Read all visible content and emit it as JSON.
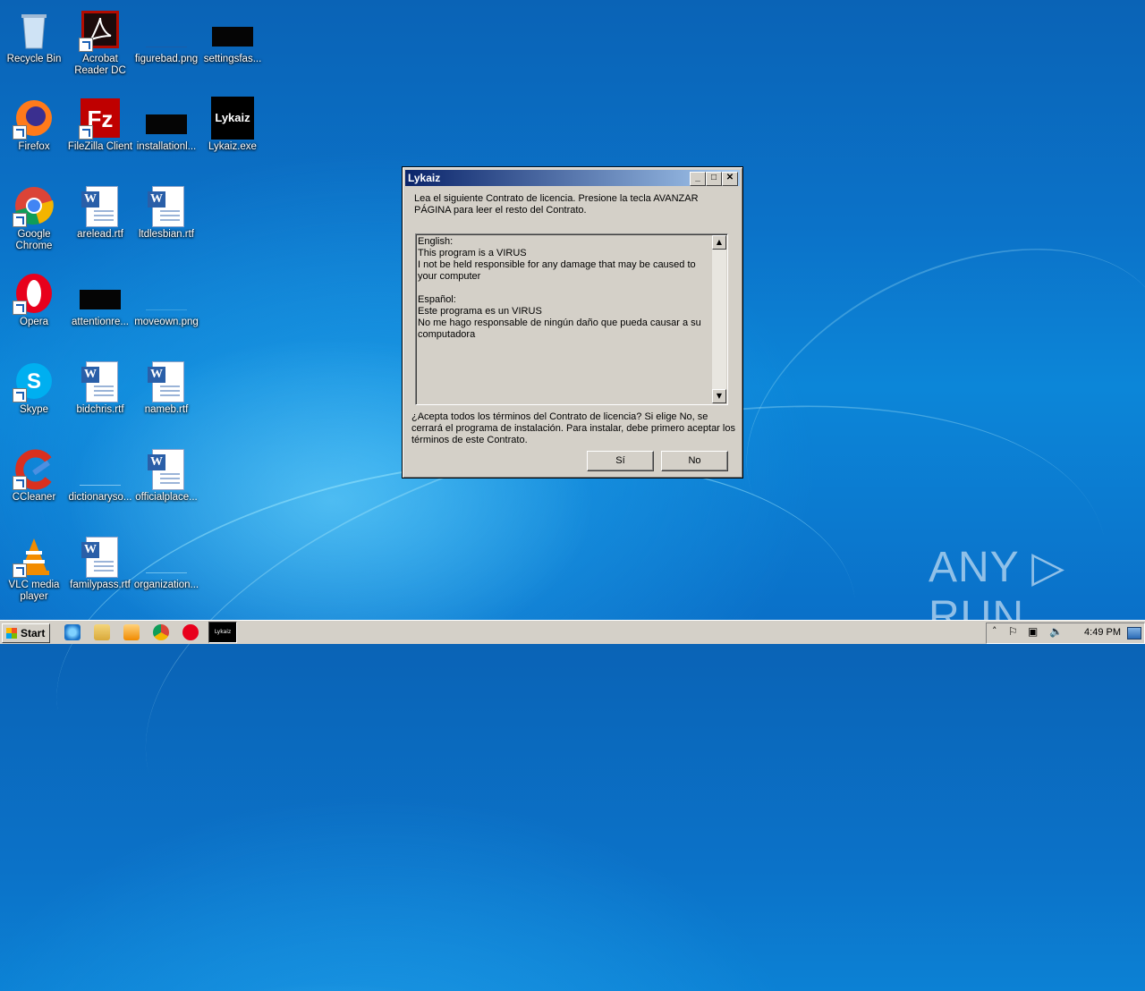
{
  "desktop": {
    "icons": [
      {
        "label": "Recycle Bin"
      },
      {
        "label": "Acrobat Reader DC"
      },
      {
        "label": "figurebad.png"
      },
      {
        "label": "settingsfas..."
      },
      {
        "label": "Firefox"
      },
      {
        "label": "FileZilla Client"
      },
      {
        "label": "installationl..."
      },
      {
        "label": "Lykaiz.exe"
      },
      {
        "label": "Google Chrome"
      },
      {
        "label": "arelead.rtf"
      },
      {
        "label": "ltdlesbian.rtf"
      },
      {
        "label": "Opera"
      },
      {
        "label": "attentionre..."
      },
      {
        "label": "moveown.png"
      },
      {
        "label": "Skype"
      },
      {
        "label": "bidchris.rtf"
      },
      {
        "label": "nameb.rtf"
      },
      {
        "label": "CCleaner"
      },
      {
        "label": "dictionaryso..."
      },
      {
        "label": "officialplace..."
      },
      {
        "label": "VLC media player"
      },
      {
        "label": "familypass.rtf"
      },
      {
        "label": "organization..."
      }
    ],
    "lykaiz_icon_text": "Lykaiz"
  },
  "dialog": {
    "title": "Lykaiz",
    "intro": "Lea el siguiente Contrato de licencia. Presione la tecla AVANZAR PÁGINA para leer el resto del Contrato.",
    "license_text": "English:\nThis program is a VIRUS\nI not be held responsible for any damage that may be caused to your computer\n\nEspañol:\nEste programa es un VIRUS\nNo me hago responsable de ningún daño que pueda causar a su computadora",
    "question": "¿Acepta todos los términos del Contrato de licencia? Si elige No, se cerrará el programa de instalación. Para instalar, debe primero aceptar los términos de este Contrato.",
    "yes_label": "Sí",
    "no_label": "No",
    "min_glyph": "_",
    "max_glyph": "□",
    "close_glyph": "✕"
  },
  "taskbar": {
    "start_label": "Start",
    "clock": "4:49 PM",
    "active_task": "Lykaiz"
  },
  "watermark": "ANY ▷ RUN"
}
